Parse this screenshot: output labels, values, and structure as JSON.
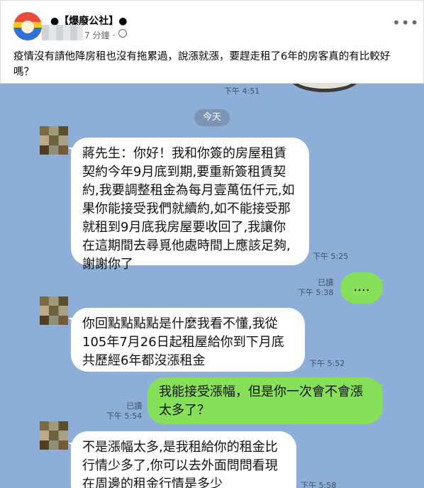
{
  "post": {
    "page_name": "●【爆廢公社】●",
    "time": "7 分鐘 · ",
    "more_icon": "•••",
    "text": "疫情沒有請他降房租也沒有拖累過，說漲就漲，要趕走租了6年的房客真的有比較好嗎？"
  },
  "chat": {
    "top_time": "下午 4:51",
    "date_chip": "今天",
    "messages": [
      {
        "side": "in",
        "text": "蔣先生：你好！我和你簽的房屋租賃契約今年9月底到期,要重新簽租賃契約,我要調整租金為每月壹萬伍仟元,如果你能接受我們就續約,如不能接受那就租到9月底我房屋要收回了,我讓你在這期間去尋覓他處時間上應該足夠,謝謝你了",
        "time": "下午 5:25"
      },
      {
        "side": "out",
        "text": "....",
        "read": "已讀",
        "time": "下午 5:38"
      },
      {
        "side": "in",
        "text": "你回點點點點是什麼我看不懂,我從105年7月26日起租屋給你到下月底共歷經6年都沒漲租金",
        "time": "下午 5:52"
      },
      {
        "side": "out",
        "text": "我能接受漲幅，但是你一次會不會漲太多了？",
        "read": "已讀",
        "time": "下午 5:54"
      },
      {
        "side": "in",
        "text": "不是漲幅太多,是我租給你的租金比行情少多了,你可以去外面問問看現在周邊的租金行情是多少",
        "time": "下午 5:58"
      }
    ]
  },
  "colors": {
    "chat_bg": "#8daed6",
    "out_bubble": "#86e05a",
    "in_bubble": "#ffffff"
  }
}
